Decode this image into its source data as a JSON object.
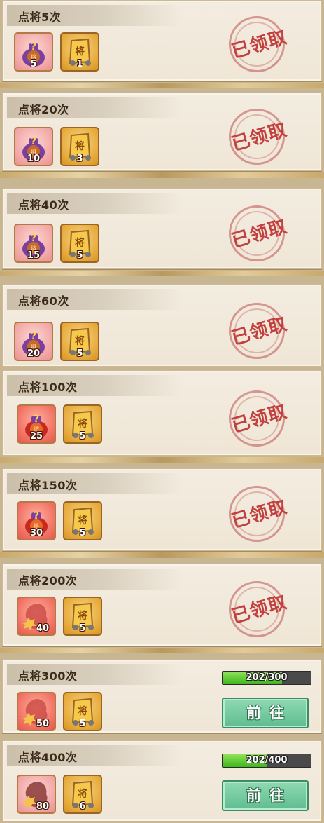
{
  "cards": [
    {
      "title": "点将5次",
      "bag_count": "5",
      "token_count": "1",
      "bag_style": "pink",
      "status": "已领取"
    },
    {
      "title": "点将20次",
      "bag_count": "10",
      "token_count": "3",
      "bag_style": "pink",
      "status": "已领取"
    },
    {
      "title": "点将40次",
      "bag_count": "15",
      "token_count": "5",
      "bag_style": "pink",
      "status": "已领取"
    },
    {
      "title": "点将60次",
      "bag_count": "20",
      "token_count": "5",
      "bag_style": "pink",
      "status": "已领取"
    },
    {
      "title": "点将100次",
      "bag_count": "25",
      "token_count": "5",
      "bag_style": "red",
      "status": "已领取"
    },
    {
      "title": "点将150次",
      "bag_count": "30",
      "token_count": "5",
      "bag_style": "red",
      "status": "已领取"
    },
    {
      "title": "点将200次",
      "bag_count": "40",
      "token_count": "5",
      "bag_style": "fragment",
      "status": "已领取"
    },
    {
      "title": "点将300次",
      "bag_count": "50",
      "token_count": "5",
      "bag_style": "fragment",
      "progress_text": "202/300",
      "progress_fraction": 0.673,
      "button_label": "前往"
    },
    {
      "title": "点将400次",
      "bag_count": "80",
      "token_count": "6",
      "bag_style": "fragment-dark",
      "progress_text": "202/400",
      "progress_fraction": 0.505,
      "button_label": "前往"
    }
  ],
  "icons": {
    "bag": "lucky-bag-icon",
    "token": "general-token-icon",
    "fragment": "general-fragment-icon",
    "token_char": "将",
    "bag_char": "将"
  },
  "colors": {
    "stamp": "#c2413f",
    "progress": "#3fb61c",
    "button": "#5fbd90"
  }
}
